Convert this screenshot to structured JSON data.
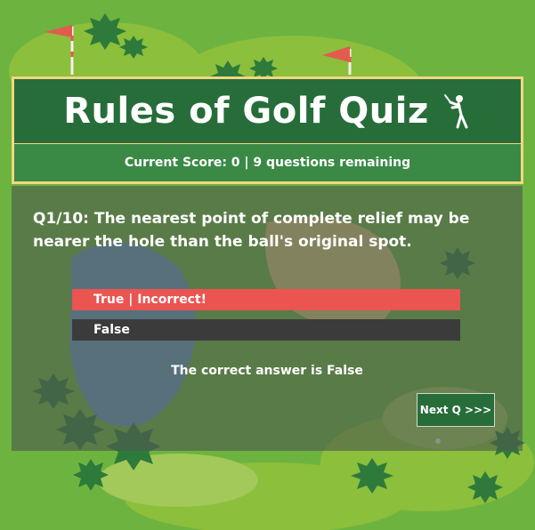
{
  "title": "Rules of Golf Quiz",
  "title_icon": "golfer-icon",
  "score_text": "Current Score: 0 | 9 questions remaining",
  "question": "Q1/10: The nearest point of complete relief may be nearer the hole than the ball's original spot.",
  "answers": [
    {
      "label": "True | Incorrect!",
      "state": "incorrect",
      "color": "#ea5451"
    },
    {
      "label": "False",
      "state": "unselected",
      "color": "#3b3b3b"
    }
  ],
  "feedback": "The correct answer is False",
  "next_label": "Next Q >>>",
  "colors": {
    "grass": "#6db33f",
    "header_green": "#276d3a",
    "score_green": "#3a8a45",
    "border_gold": "#f2d77e",
    "flag_red": "#e25b4f"
  }
}
